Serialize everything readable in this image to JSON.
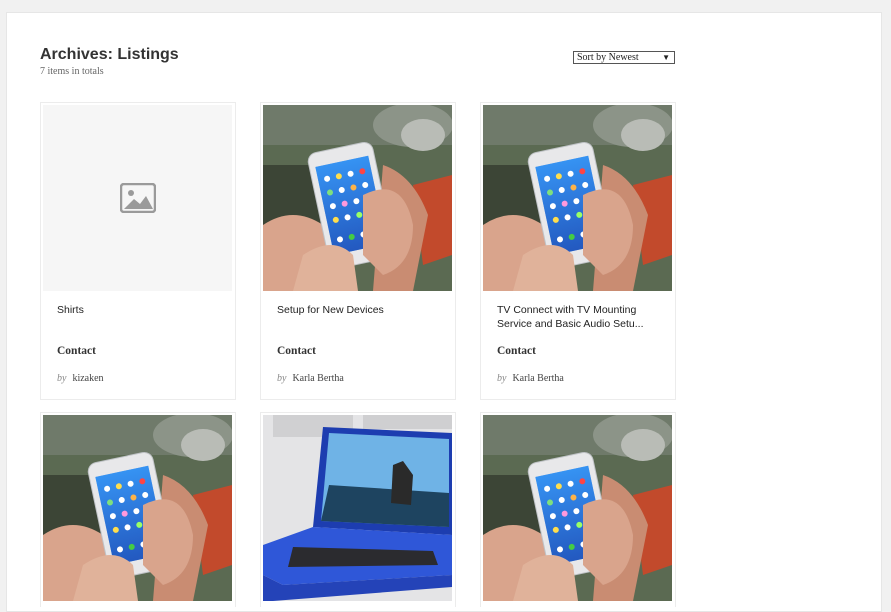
{
  "archive": {
    "title": "Archives: Listings",
    "count_text": "7 items in totals",
    "sort": {
      "selected": "Sort by Newest"
    }
  },
  "listings": [
    {
      "title": "Shirts",
      "contact_label": "Contact",
      "by_label": "by",
      "author": "kizaken",
      "image": "placeholder-image-icon"
    },
    {
      "title": "Setup for New Devices",
      "contact_label": "Contact",
      "by_label": "by",
      "author": "Karla Bertha",
      "image": "phone-photo"
    },
    {
      "title": "TV Connect with TV Mounting Service and Basic Audio Setu...",
      "contact_label": "Contact",
      "by_label": "by",
      "author": "Karla Bertha",
      "image": "phone-photo"
    },
    {
      "image": "phone-photo"
    },
    {
      "image": "laptop-photo"
    },
    {
      "image": "phone-photo"
    }
  ],
  "colors": {
    "laptop": "#2f57d8",
    "screen_sky": "#6fb3e6",
    "phone_screen": "#2f7fe0",
    "background": "#f1f1f1"
  }
}
